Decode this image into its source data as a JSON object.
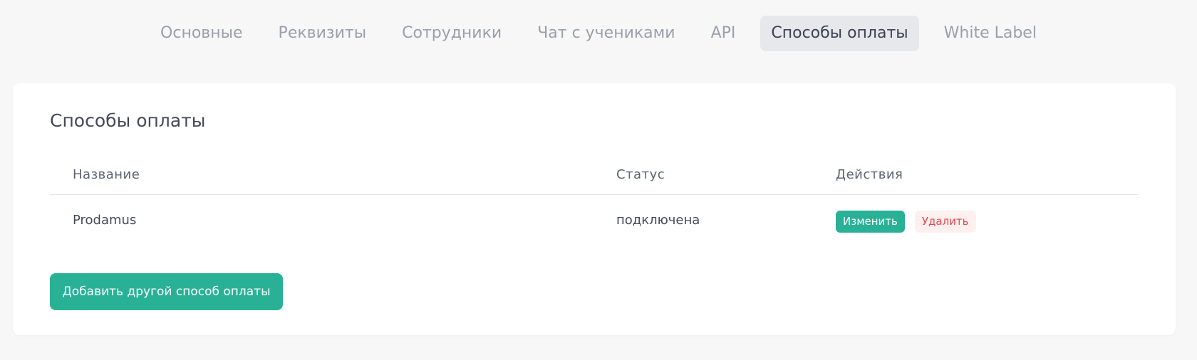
{
  "tabs": [
    {
      "label": "Основные",
      "active": false
    },
    {
      "label": "Реквизиты",
      "active": false
    },
    {
      "label": "Сотрудники",
      "active": false
    },
    {
      "label": "Чат с учениками",
      "active": false
    },
    {
      "label": "API",
      "active": false
    },
    {
      "label": "Способы оплаты",
      "active": true
    },
    {
      "label": "White Label",
      "active": false
    }
  ],
  "card": {
    "title": "Способы оплаты",
    "table": {
      "headers": {
        "name": "Название",
        "status": "Статус",
        "actions": "Действия"
      },
      "rows": [
        {
          "name": "Prodamus",
          "status": "подключена",
          "edit_label": "Изменить",
          "delete_label": "Удалить"
        }
      ]
    },
    "add_button_label": "Добавить другой способ оплаты"
  },
  "colors": {
    "accent": "#29b196",
    "danger": "#e5484d",
    "danger_bg": "#fff0f0",
    "active_tab_bg": "#e7e8ec"
  }
}
